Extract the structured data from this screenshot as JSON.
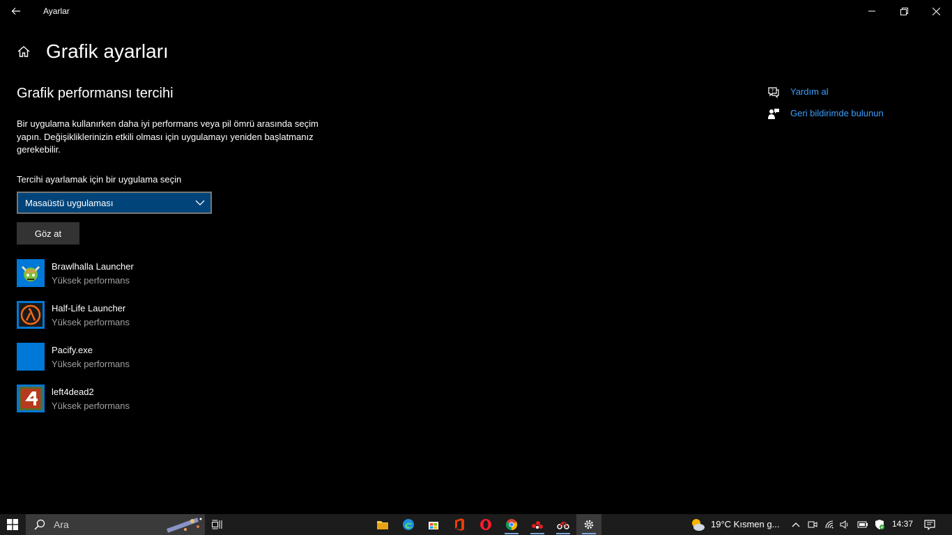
{
  "window": {
    "title": "Ayarlar"
  },
  "page": {
    "title": "Grafik ayarları"
  },
  "section": {
    "title": "Grafik performansı tercihi",
    "description": "Bir uygulama kullanırken daha iyi performans veya pil ömrü arasında seçim yapın. Değişikliklerinizin etkili olması için uygulamayı yeniden başlatmanız gerekebilir.",
    "select_label": "Tercihi ayarlamak için bir uygulama seçin",
    "select_value": "Masaüstü uygulaması",
    "browse_label": "Göz at"
  },
  "apps": [
    {
      "name": "Brawlhalla Launcher",
      "preference": "Yüksek performans",
      "icon": "brawlhalla-icon"
    },
    {
      "name": "Half-Life Launcher",
      "preference": "Yüksek performans",
      "icon": "half-life-lambda-icon"
    },
    {
      "name": "Pacify.exe",
      "preference": "Yüksek performans",
      "icon": "blank-app-icon"
    },
    {
      "name": "left4dead2",
      "preference": "Yüksek performans",
      "icon": "left4dead-icon"
    }
  ],
  "side": {
    "help": "Yardım al",
    "feedback": "Geri bildirimde bulunun"
  },
  "taskbar": {
    "search_placeholder": "Ara",
    "weather": "19°C  Kısmen g...",
    "time": "14:37"
  },
  "colors": {
    "accent": "#0078d7",
    "link": "#3a9fff",
    "select_bg": "#00447a"
  }
}
